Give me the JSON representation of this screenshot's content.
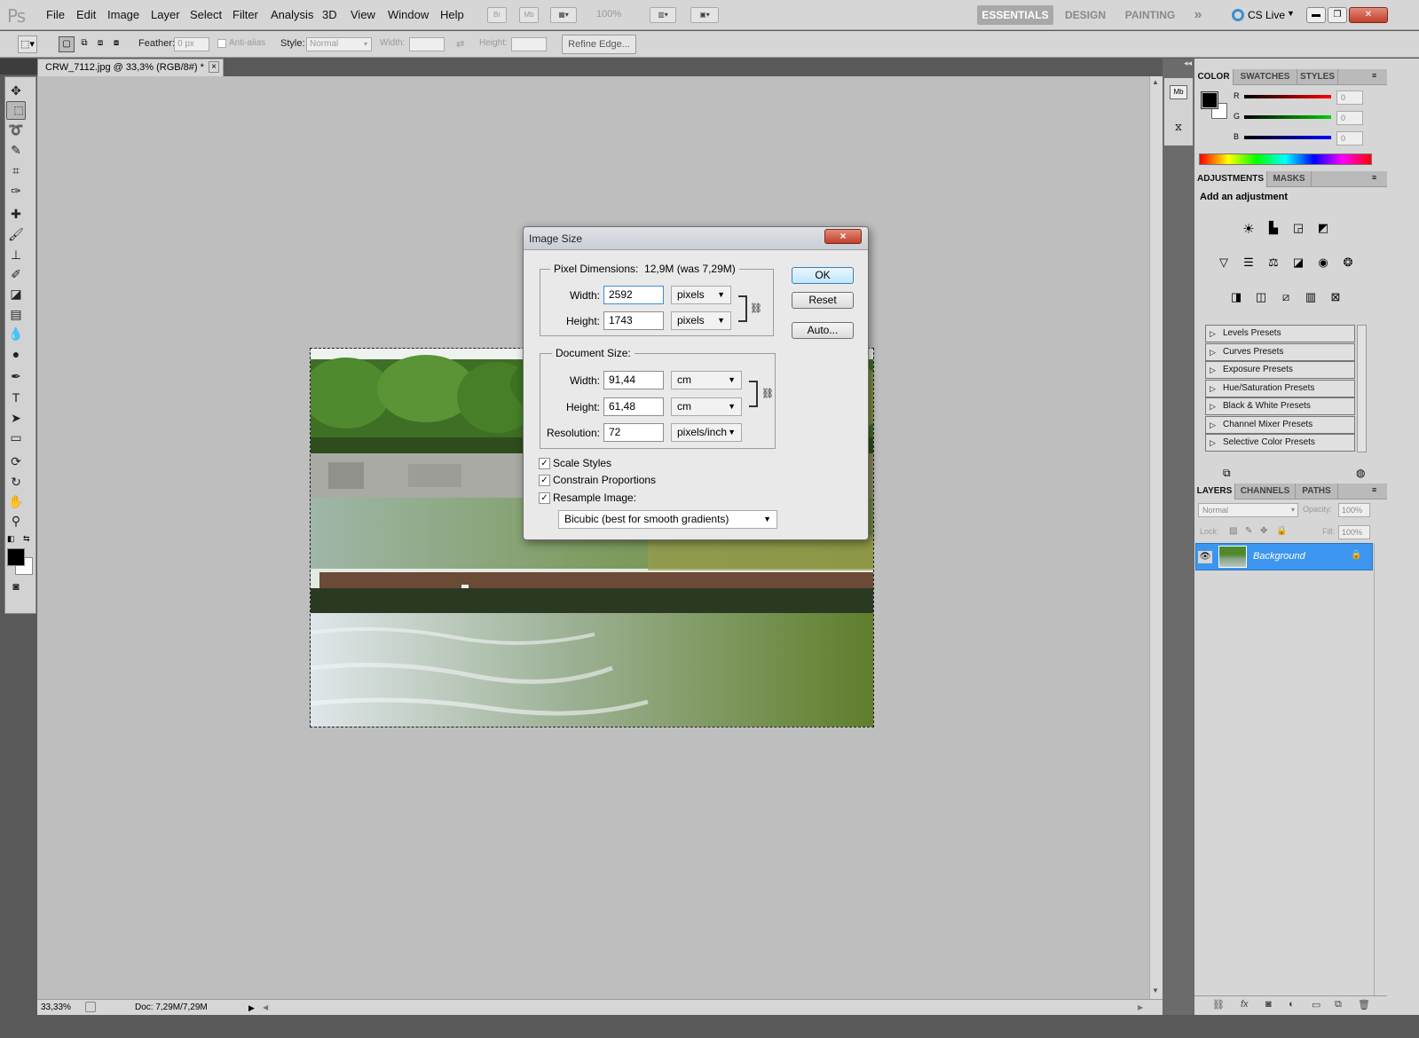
{
  "app": {
    "logo": "Ps"
  },
  "menu": [
    "File",
    "Edit",
    "Image",
    "Layer",
    "Select",
    "Filter",
    "Analysis",
    "3D",
    "View",
    "Window",
    "Help"
  ],
  "menubar": {
    "bridge": "Br",
    "minibridge": "Mb",
    "zoom": "100%"
  },
  "workspaces": {
    "essentials": "ESSENTIALS",
    "design": "DESIGN",
    "painting": "PAINTING",
    "more": "»",
    "cslive": "CS Live"
  },
  "options": {
    "feather_label": "Feather:",
    "feather_value": "0 px",
    "antialias": "Anti-alias",
    "style_label": "Style:",
    "style_value": "Normal",
    "width_label": "Width:",
    "height_label": "Height:",
    "refine_edge": "Refine Edge..."
  },
  "document": {
    "tab_title": "CRW_7112.jpg @ 33,3% (RGB/8#) *",
    "close": "×"
  },
  "status": {
    "zoom": "33,33%",
    "doc": "Doc: 7,29M/7,29M"
  },
  "color_panel": {
    "tabs": [
      "COLOR",
      "SWATCHES",
      "STYLES"
    ],
    "r_label": "R",
    "g_label": "G",
    "b_label": "B",
    "r": "0",
    "g": "0",
    "b": "0"
  },
  "adjustments": {
    "tabs": [
      "ADJUSTMENTS",
      "MASKS"
    ],
    "heading": "Add an adjustment",
    "presets": [
      "Levels Presets",
      "Curves Presets",
      "Exposure Presets",
      "Hue/Saturation Presets",
      "Black & White Presets",
      "Channel Mixer Presets",
      "Selective Color Presets"
    ]
  },
  "layers": {
    "tabs": [
      "LAYERS",
      "CHANNELS",
      "PATHS"
    ],
    "blend": "Normal",
    "opacity_label": "Opacity:",
    "opacity": "100%",
    "lock_label": "Lock:",
    "fill_label": "Fill:",
    "fill": "100%",
    "layer_name": "Background"
  },
  "dialog": {
    "title": "Image Size",
    "close": "×",
    "pixel_dimensions_label": "Pixel Dimensions:",
    "pixel_dimensions_value": "12,9M (was 7,29M)",
    "pd_width_label": "Width:",
    "pd_width": "2592",
    "pd_width_unit": "pixels",
    "pd_height_label": "Height:",
    "pd_height": "1743",
    "pd_height_unit": "pixels",
    "document_size_label": "Document Size:",
    "ds_width_label": "Width:",
    "ds_width": "91,44",
    "ds_width_unit": "cm",
    "ds_height_label": "Height:",
    "ds_height": "61,48",
    "ds_height_unit": "cm",
    "resolution_label": "Resolution:",
    "resolution": "72",
    "resolution_unit": "pixels/inch",
    "scale_styles": "Scale Styles",
    "constrain": "Constrain Proportions",
    "resample": "Resample Image:",
    "resample_method": "Bicubic (best for smooth gradients)",
    "ok": "OK",
    "reset": "Reset",
    "auto": "Auto..."
  },
  "colors": {
    "accent": "#3d8ee0",
    "layer_selected": "#3c96f0"
  }
}
